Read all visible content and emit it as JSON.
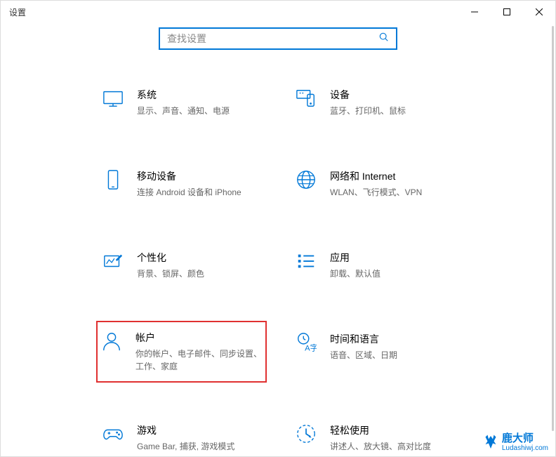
{
  "window": {
    "title": "设置"
  },
  "search": {
    "placeholder": "查找设置"
  },
  "tiles": {
    "system": {
      "title": "系统",
      "desc": "显示、声音、通知、电源"
    },
    "devices": {
      "title": "设备",
      "desc": "蓝牙、打印机、鼠标"
    },
    "phone": {
      "title": "移动设备",
      "desc": "连接 Android 设备和 iPhone"
    },
    "network": {
      "title": "网络和 Internet",
      "desc": "WLAN、飞行模式、VPN"
    },
    "personalization": {
      "title": "个性化",
      "desc": "背景、锁屏、颜色"
    },
    "apps": {
      "title": "应用",
      "desc": "卸载、默认值"
    },
    "accounts": {
      "title": "帐户",
      "desc": "你的帐户、电子邮件、同步设置、工作、家庭"
    },
    "time": {
      "title": "时间和语言",
      "desc": "语音、区域、日期"
    },
    "gaming": {
      "title": "游戏",
      "desc": "Game Bar, 捕获, 游戏模式"
    },
    "ease": {
      "title": "轻松使用",
      "desc": "讲述人、放大镜、高对比度"
    }
  },
  "watermark": {
    "name": "鹿大师",
    "url": "Ludashiwj.com"
  }
}
